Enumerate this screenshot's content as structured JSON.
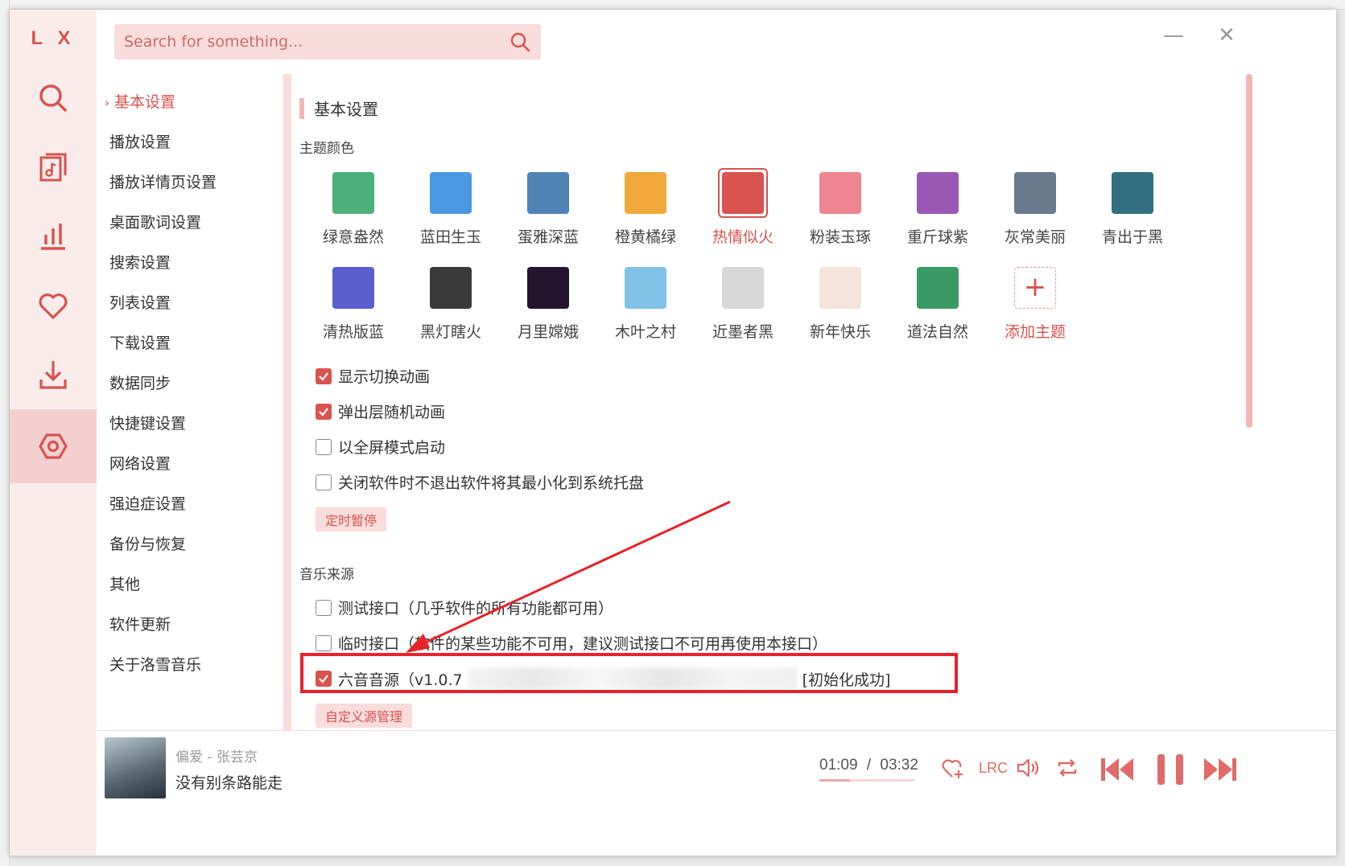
{
  "app": {
    "logo": "L X"
  },
  "search": {
    "placeholder": "Search for something..."
  },
  "window": {
    "minimize": "—",
    "close": "✕"
  },
  "rail": {
    "items": [
      {
        "icon": "search-icon"
      },
      {
        "icon": "music-list-icon"
      },
      {
        "icon": "chart-icon"
      },
      {
        "icon": "heart-icon"
      },
      {
        "icon": "download-icon"
      },
      {
        "icon": "settings-icon",
        "active": true
      }
    ]
  },
  "nav": {
    "items": [
      {
        "label": "基本设置",
        "active": true
      },
      {
        "label": "播放设置"
      },
      {
        "label": "播放详情页设置"
      },
      {
        "label": "桌面歌词设置"
      },
      {
        "label": "搜索设置"
      },
      {
        "label": "列表设置"
      },
      {
        "label": "下载设置"
      },
      {
        "label": "数据同步"
      },
      {
        "label": "快捷键设置"
      },
      {
        "label": "网络设置"
      },
      {
        "label": "强迫症设置"
      },
      {
        "label": "备份与恢复"
      },
      {
        "label": "其他"
      },
      {
        "label": "软件更新"
      },
      {
        "label": "关于洛雪音乐"
      }
    ]
  },
  "settings": {
    "section_title": "基本设置",
    "theme_title": "主题颜色",
    "themes": [
      {
        "label": "绿意盎然",
        "color": "#4daf7c"
      },
      {
        "label": "蓝田生玉",
        "color": "#4a98e0"
      },
      {
        "label": "蛋雅深蓝",
        "color": "#4f83b8"
      },
      {
        "label": "橙黄橘绿",
        "color": "#f0a938"
      },
      {
        "label": "热情似火",
        "color": "#d9534f",
        "selected": true
      },
      {
        "label": "粉装玉琢",
        "color": "#ee8590"
      },
      {
        "label": "重斤球紫",
        "color": "#9b58b5"
      },
      {
        "label": "灰常美丽",
        "color": "#6b7a8e"
      },
      {
        "label": "青出于黑",
        "color": "#33707f"
      },
      {
        "label": "清热版蓝",
        "color": "#5a5fd0"
      },
      {
        "label": "黑灯瞎火",
        "color": "#3a3a3a"
      },
      {
        "label": "月里嫦娥",
        "color": "#24142e"
      },
      {
        "label": "木叶之村",
        "color": "#7fc2e6"
      },
      {
        "label": "近墨者黑",
        "color": "#d8d8d8"
      },
      {
        "label": "新年快乐",
        "color": "#f5e4dc"
      },
      {
        "label": "道法自然",
        "color": "#3a9a66"
      },
      {
        "label": "添加主题",
        "color": "#ffffff",
        "add": true
      }
    ],
    "checkboxes": [
      {
        "label": "显示切换动画",
        "checked": true
      },
      {
        "label": "弹出层随机动画",
        "checked": true
      },
      {
        "label": "以全屏模式启动",
        "checked": false
      },
      {
        "label": "关闭软件时不退出软件将其最小化到系统托盘",
        "checked": false
      }
    ],
    "timer_button": "定时暂停",
    "source_title": "音乐来源",
    "sources": [
      {
        "label": "测试接口（几乎软件的所有功能都可用）",
        "checked": false
      },
      {
        "label": "临时接口（软件的某些功能不可用，建议测试接口不可用再使用本接口）",
        "checked": false
      }
    ],
    "custom_source": {
      "label_prefix": "六音音源（v1.0.7",
      "label_suffix": "[初始化成功]",
      "checked": true
    },
    "custom_source_button": "自定义源管理"
  },
  "player": {
    "title": "偏爱 - 张芸京",
    "lyric": "没有别条路能走",
    "current_time": "01:09",
    "separator": "/",
    "total_time": "03:32",
    "progress": 0.325,
    "lrc_label": "LRC"
  },
  "accent_color": "#d9534f"
}
